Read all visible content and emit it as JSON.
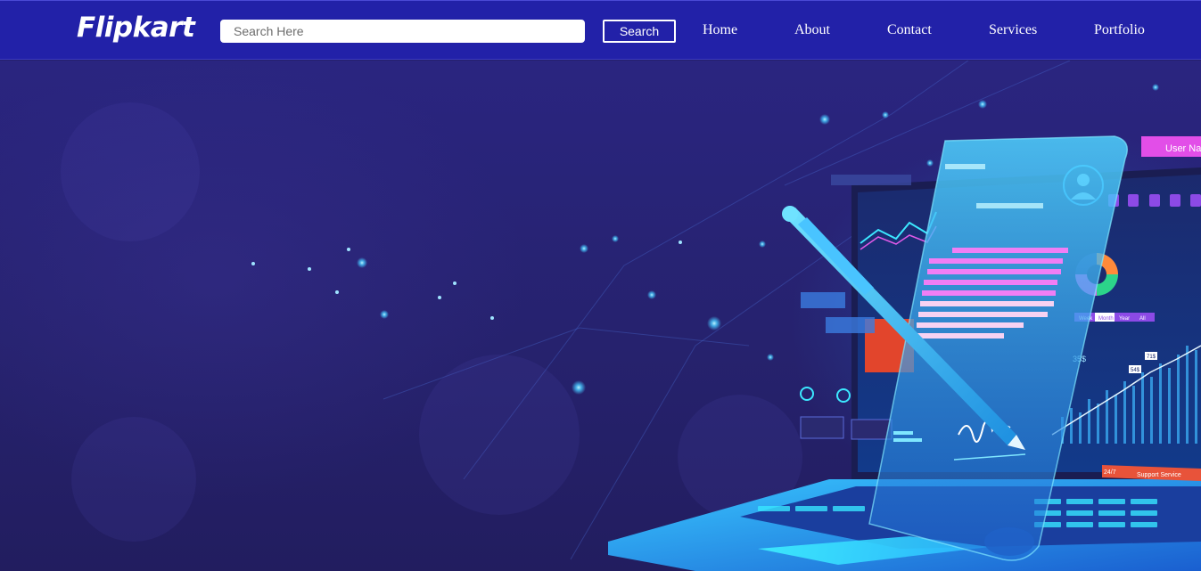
{
  "header": {
    "logo": "Flipkart",
    "search": {
      "placeholder": "Search Here",
      "value": ""
    },
    "search_button": "Search",
    "nav": [
      "Home",
      "About",
      "Contact",
      "Services",
      "Portfolio"
    ]
  },
  "hero": {
    "illustration": {
      "description_icon": "laptop-document-pen",
      "panel_user_label": "User Nam",
      "support_label": "Support Service",
      "support_prefix": "24/7",
      "tabs": [
        "Week",
        "Month",
        "Year",
        "All"
      ],
      "value_label": "35$",
      "price_tags": [
        "71$",
        "54$"
      ]
    }
  },
  "colors": {
    "nav_bg": "#2221a8",
    "hero_bg": "#26226e",
    "accent_cyan": "#2fd2ff",
    "accent_pink": "#e056e6"
  }
}
